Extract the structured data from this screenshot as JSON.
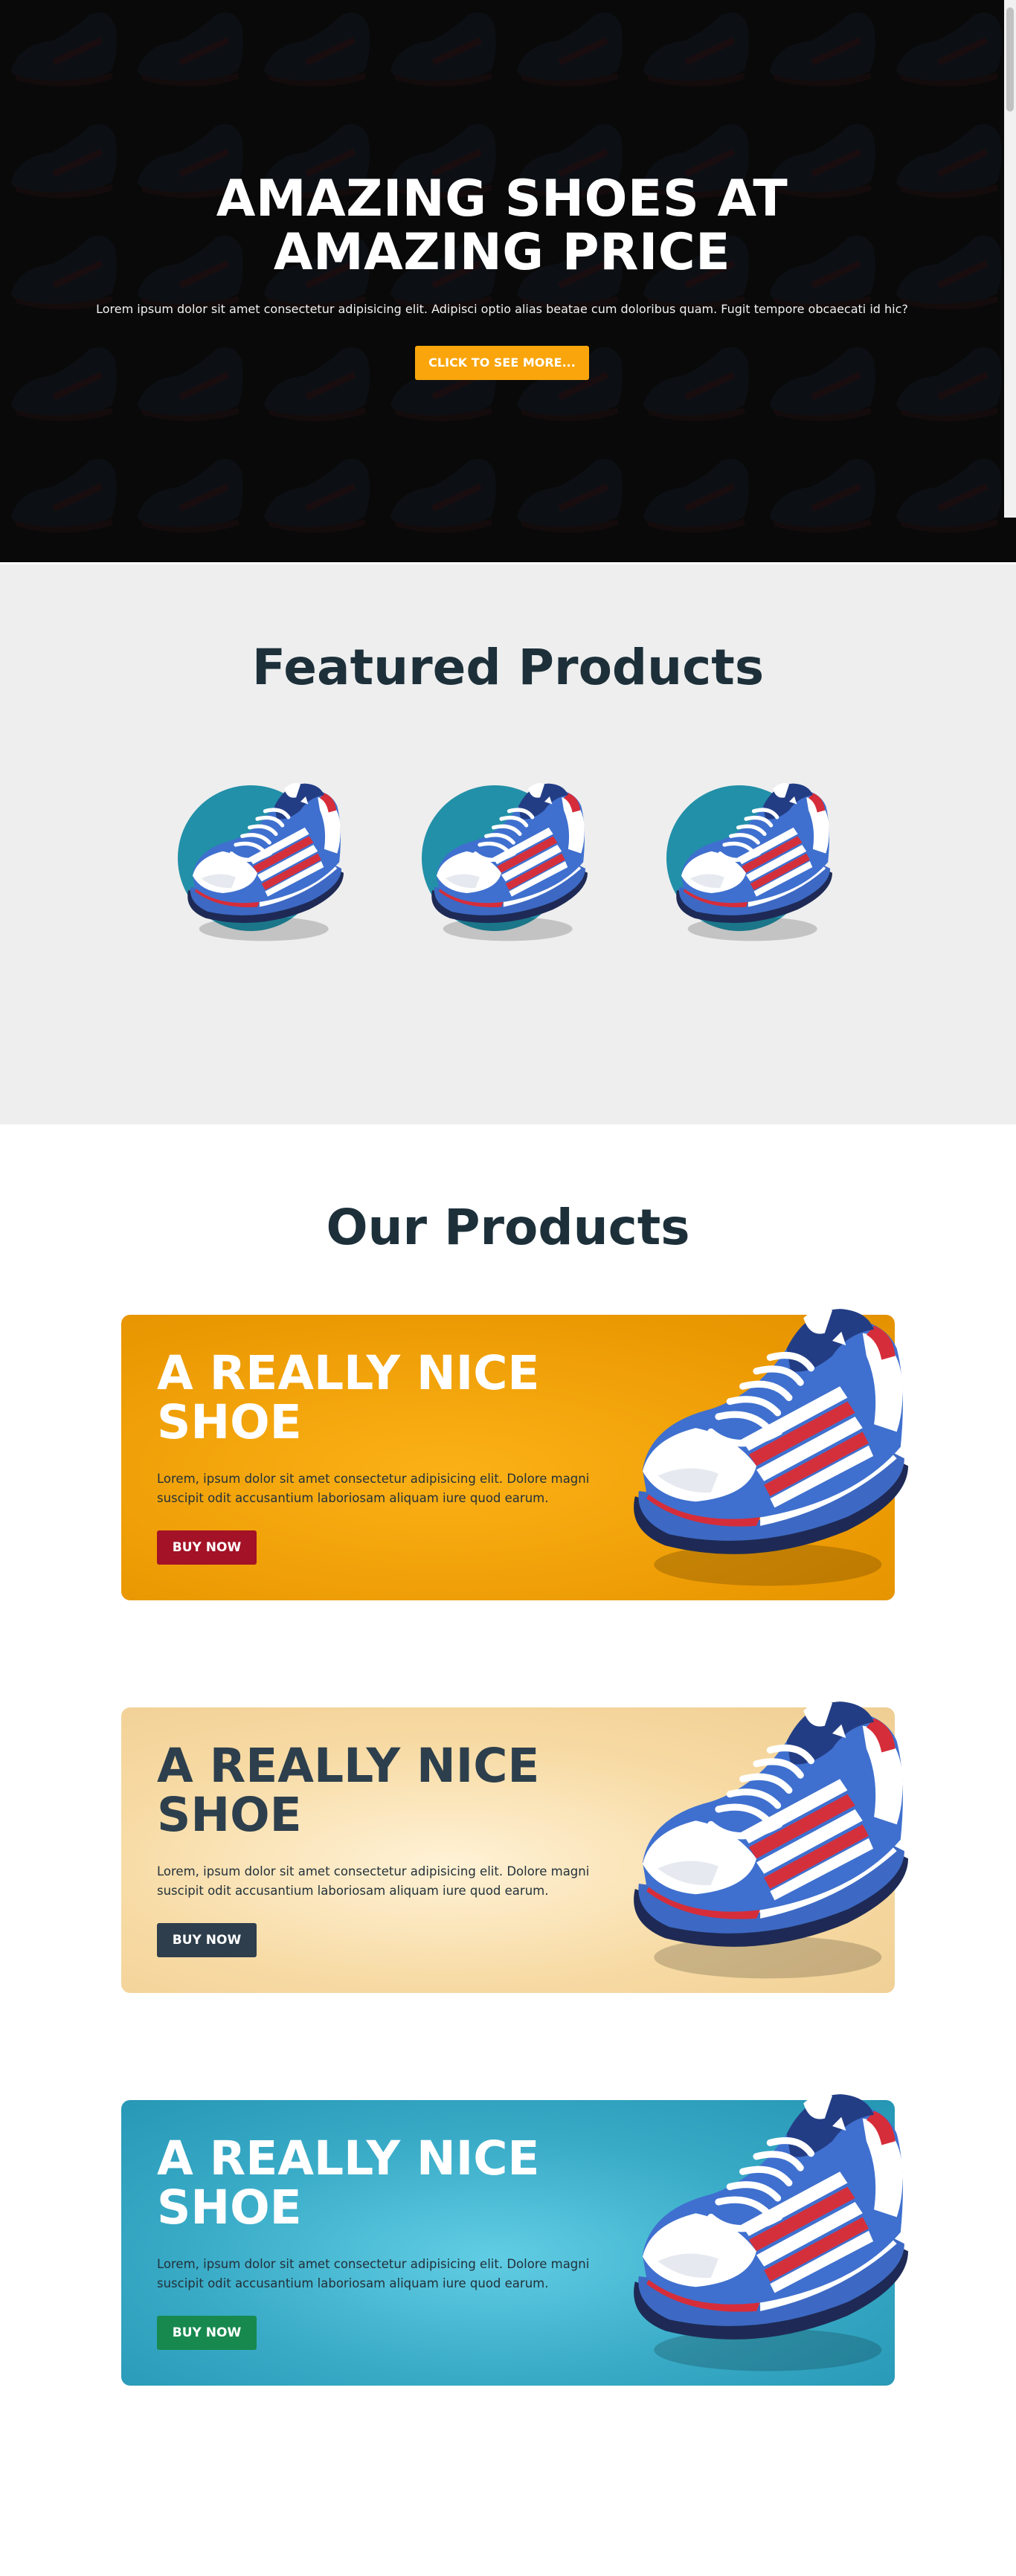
{
  "hero": {
    "title": "AMAZING SHOES AT AMAZING PRICE",
    "text": "Lorem ipsum dolor sit amet consectetur adipisicing elit. Adipisci optio alias beatae cum doloribus quam. Fugit tempore obcaecati id hic?",
    "cta_label": "CLICK TO SEE MORE..."
  },
  "featured": {
    "title": "Featured Products",
    "items": [
      {
        "icon": "sneaker-image"
      },
      {
        "icon": "sneaker-image"
      },
      {
        "icon": "sneaker-image"
      }
    ]
  },
  "products": {
    "title": "Our Products",
    "cards": [
      {
        "title": "A REALLY NICE SHOE",
        "text": "Lorem, ipsum dolor sit amet consectetur adipisicing elit. Dolore magni suscipit odit accusantium laboriosam aliquam iure quod earum.",
        "button_label": "BUY NOW",
        "background": "#ec9a03",
        "button_color": "#a31226"
      },
      {
        "title": "A REALLY NICE SHOE",
        "text": "Lorem, ipsum dolor sit amet consectetur adipisicing elit. Dolore magni suscipit odit accusantium laboriosam aliquam iure quod earum.",
        "button_label": "BUY NOW",
        "background": "#f7daa3",
        "button_color": "#2e3e4c"
      },
      {
        "title": "A REALLY NICE SHOE",
        "text": "Lorem, ipsum dolor sit amet consectetur adipisicing elit. Dolore magni suscipit odit accusantium laboriosam aliquam iure quod earum.",
        "button_label": "BUY NOW",
        "background": "#38aac6",
        "button_color": "#17894f"
      }
    ]
  },
  "colors": {
    "accent": "#f9a50b",
    "heading": "#1d303a"
  }
}
